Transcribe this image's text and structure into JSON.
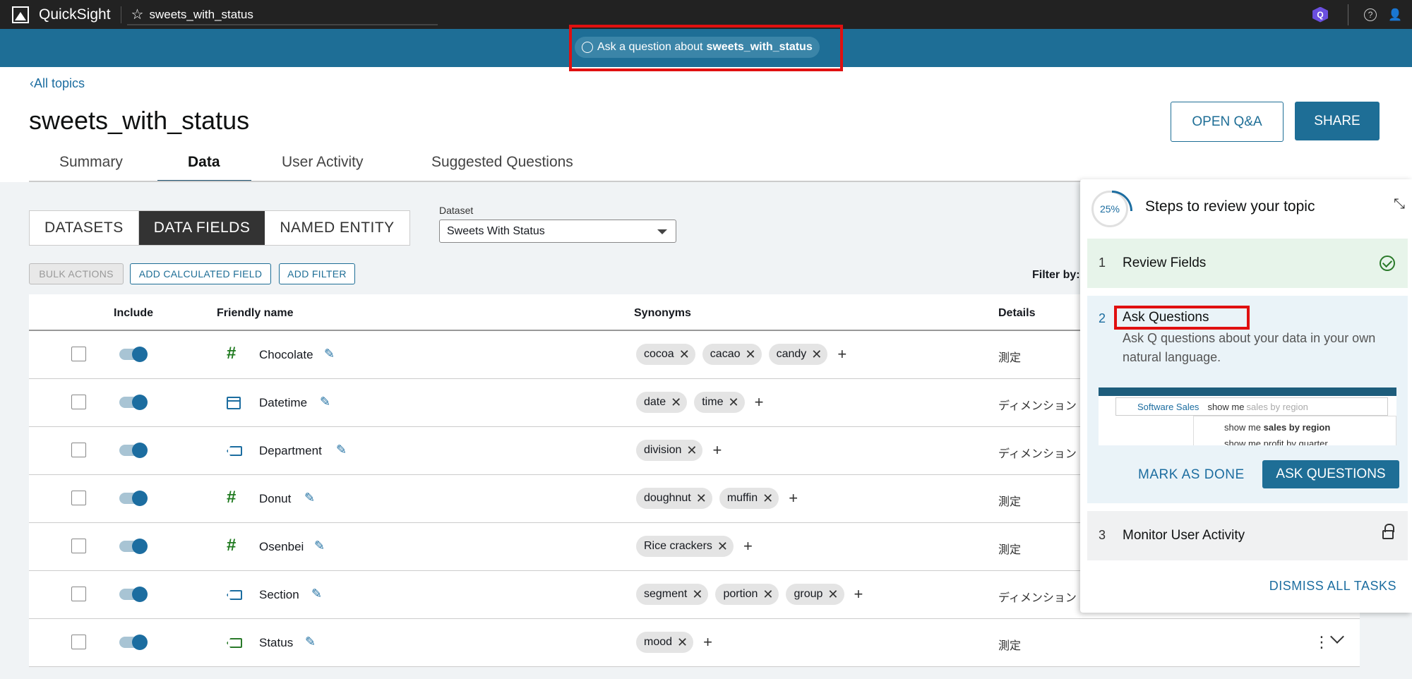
{
  "topbar": {
    "app_name": "QuickSight",
    "topic_name": "sweets_with_status",
    "help_glyph": "?",
    "user_glyph": "👤"
  },
  "question_bar": {
    "prefix": "Ask a question about",
    "topic": "sweets_with_status"
  },
  "header": {
    "back_label": "All topics",
    "title": "sweets_with_status",
    "open_qa_label": "OPEN Q&A",
    "share_label": "SHARE"
  },
  "tabs": [
    "Summary",
    "Data",
    "User Activity",
    "Suggested Questions"
  ],
  "segments": [
    "DATASETS",
    "DATA FIELDS",
    "NAMED ENTITY"
  ],
  "dataset": {
    "label": "Dataset",
    "value": "Sweets With Status"
  },
  "actions": {
    "bulk": "BULK ACTIONS",
    "calc": "ADD CALCULATED FIELD",
    "filter": "ADD FILTER",
    "filter_by": "Filter by:"
  },
  "table": {
    "headers": {
      "include": "Include",
      "name": "Friendly name",
      "synonyms": "Synonyms",
      "details": "Details"
    },
    "rows": [
      {
        "name": "Chocolate",
        "icon": "hash-icon",
        "synonyms": [
          "cocoa",
          "cacao",
          "candy"
        ],
        "details": "測定"
      },
      {
        "name": "Datetime",
        "icon": "calendar-icon",
        "synonyms": [
          "date",
          "time"
        ],
        "details": "ディメンション"
      },
      {
        "name": "Department",
        "icon": "tag-icon",
        "synonyms": [
          "division"
        ],
        "details": "ディメンション"
      },
      {
        "name": "Donut",
        "icon": "hash-icon",
        "synonyms": [
          "doughnut",
          "muffin"
        ],
        "details": "測定"
      },
      {
        "name": "Osenbei",
        "icon": "hash-icon",
        "synonyms": [
          "Rice crackers"
        ],
        "details": "測定"
      },
      {
        "name": "Section",
        "icon": "tag-icon",
        "synonyms": [
          "segment",
          "portion",
          "group"
        ],
        "details": "ディメンション"
      },
      {
        "name": "Status",
        "icon": "tag-green-icon",
        "synonyms": [
          "mood"
        ],
        "details": "測定"
      }
    ]
  },
  "panel": {
    "progress": "25%",
    "title": "Steps to review your topic",
    "step1": {
      "num": "1",
      "title": "Review Fields"
    },
    "step2": {
      "num": "2",
      "title": "Ask Questions",
      "desc": "Ask Q questions about your data in your own natural language.",
      "preview_topic": "Software Sales",
      "preview_typed": "show me",
      "preview_placeholder": "sales by region",
      "preview_suggest1_prefix": "show me ",
      "preview_suggest1_bold": "sales by region",
      "preview_suggest2": "show me profit by quarter",
      "mark_label": "MARK AS DONE",
      "ask_label": "ASK QUESTIONS"
    },
    "step3": {
      "num": "3",
      "title": "Monitor User Activity"
    },
    "dismiss_label": "DISMISS ALL TASKS"
  },
  "colors": {
    "primary": "#1e6e96",
    "highlight": "#e01010",
    "topbar": "#222222"
  }
}
